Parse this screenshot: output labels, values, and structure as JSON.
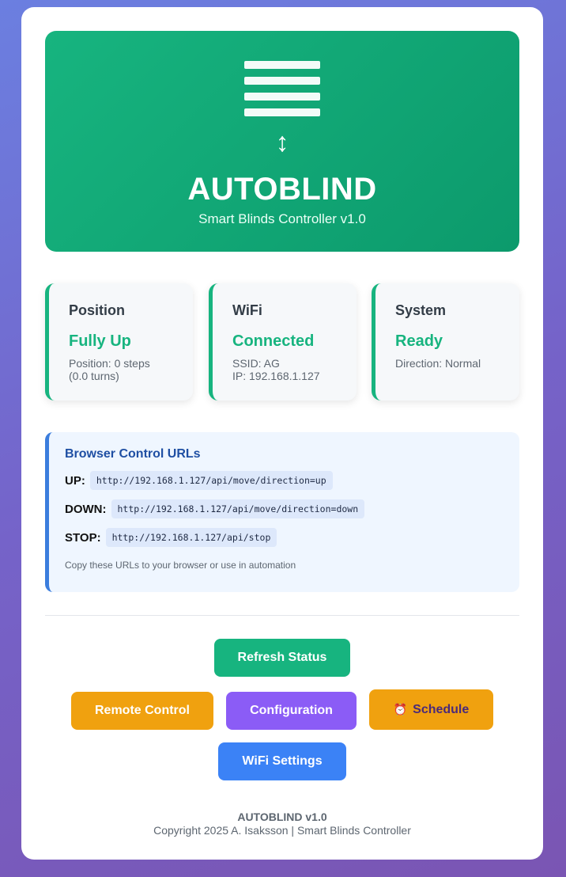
{
  "hero": {
    "title": "AUTOBLIND",
    "subtitle": "Smart Blinds Controller v1.0",
    "arrow": "↕"
  },
  "status": [
    {
      "label": "Position",
      "value": "Fully Up",
      "details": [
        "Position: 0 steps",
        "(0.0 turns)"
      ]
    },
    {
      "label": "WiFi",
      "value": "Connected",
      "details": [
        "SSID: AG",
        "IP: 192.168.1.127"
      ]
    },
    {
      "label": "System",
      "value": "Ready",
      "details": [
        "Direction: Normal"
      ]
    }
  ],
  "urls": {
    "title": "Browser Control URLs",
    "items": [
      {
        "label": "UP:",
        "url": "http://192.168.1.127/api/move/direction=up"
      },
      {
        "label": "DOWN:",
        "url": "http://192.168.1.127/api/move/direction=down"
      },
      {
        "label": "STOP:",
        "url": "http://192.168.1.127/api/stop"
      }
    ],
    "note": "Copy these URLs to your browser or use in automation"
  },
  "buttons": {
    "refresh": "Refresh Status",
    "remote": "Remote Control",
    "config": "Configuration",
    "schedule": "Schedule",
    "wifi": "WiFi Settings"
  },
  "icons": {
    "blinds": "blinds-icon",
    "arrow": "up-down-arrow-icon",
    "schedule": "alarm-clock-icon",
    "schedule_glyph": "⏰"
  },
  "colors": {
    "accent_green": "#17b47f",
    "orange": "#f0a10f",
    "purple": "#8b5cf6",
    "blue": "#3b82f6"
  },
  "footer": {
    "title": "AUTOBLIND v1.0",
    "copyright": "Copyright 2025 A. Isaksson | Smart Blinds Controller"
  }
}
